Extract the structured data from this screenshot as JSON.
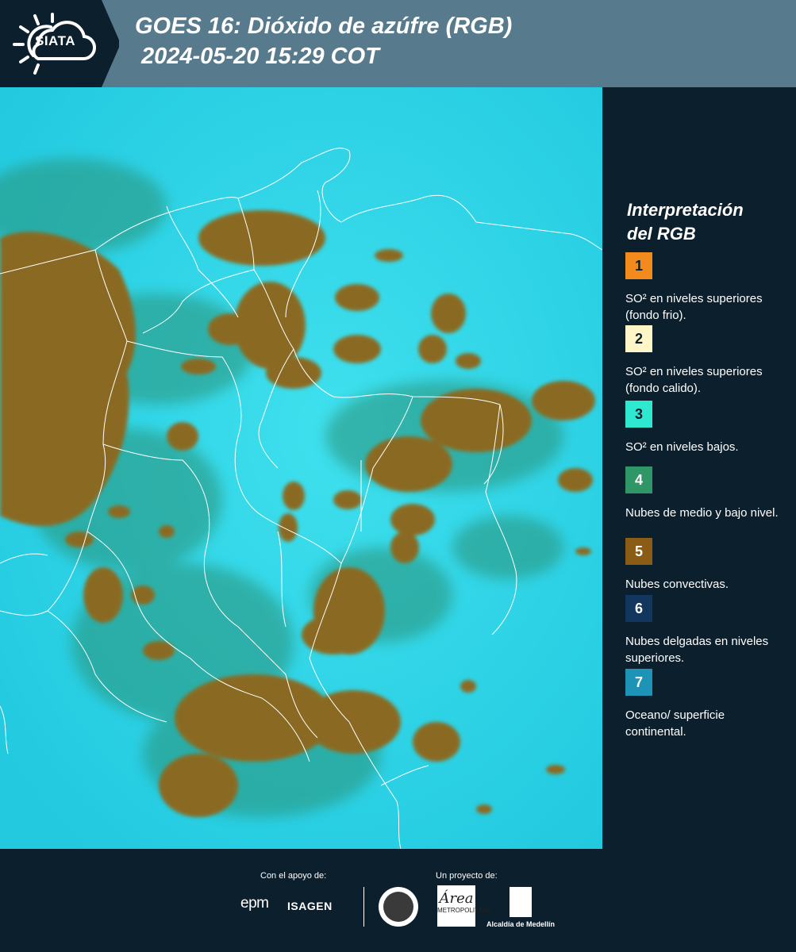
{
  "header": {
    "logo_text": "SIATA",
    "title_line1": "GOES 16: Dióxido de azúfre (RGB)",
    "title_line2": "2024-05-20 15:29 COT"
  },
  "legend": {
    "title_line1": "Interpretación",
    "title_line2": "del RGB",
    "items": [
      {
        "num": "1",
        "color": "#f28a1e",
        "text_color": "#0c1f2c",
        "label": "SO² en niveles superiores (fondo frio)."
      },
      {
        "num": "2",
        "color": "#fff6c8",
        "text_color": "#0c1f2c",
        "label": "SO² en niveles superiores (fondo calido)."
      },
      {
        "num": "3",
        "color": "#2ee8cf",
        "text_color": "#0c1f2c",
        "label": "SO² en niveles bajos."
      },
      {
        "num": "4",
        "color": "#2f9668",
        "text_color": "#ffffff",
        "label": "Nubes de medio y bajo nivel."
      },
      {
        "num": "5",
        "color": "#8a5c16",
        "text_color": "#ffffff",
        "label": "Nubes convectivas."
      },
      {
        "num": "6",
        "color": "#12365e",
        "text_color": "#ffffff",
        "label": "Nubes delgadas en niveles superiores."
      },
      {
        "num": "7",
        "color": "#1d93b6",
        "text_color": "#ffffff",
        "label": "Oceano/ superficie continental."
      }
    ]
  },
  "map_colors": {
    "background": "#2fd6e8",
    "convective": "#8a6a22",
    "midlevel": "#2d8a6a",
    "borders": "#ffffff"
  },
  "footer": {
    "support_label": "Con el apoyo de:",
    "project_label": "Un proyecto de:",
    "epm": "epm",
    "isagen": "ISAGEN",
    "area_big": "Área",
    "area_small": "METROPOLITANA",
    "alcaldia": "Alcaldía de Medellín"
  }
}
